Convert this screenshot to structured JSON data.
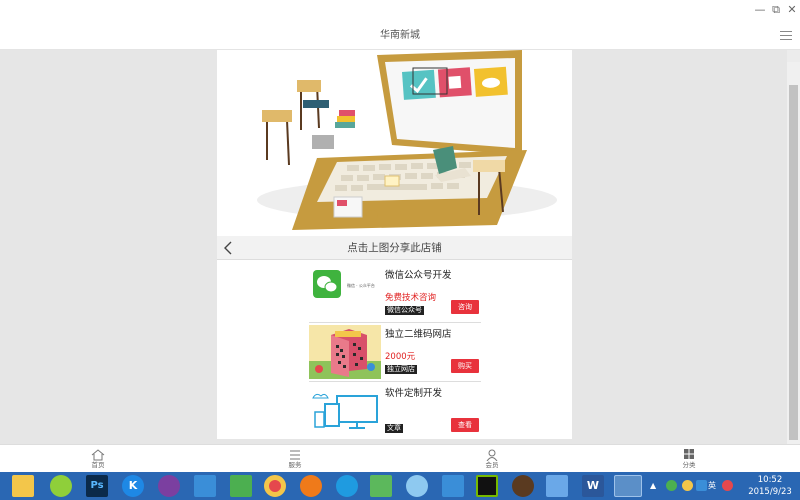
{
  "window": {
    "title": "华南新城",
    "controls": {
      "minimize": "—",
      "restore": "⧉",
      "close": "✕"
    }
  },
  "share_bar": {
    "text": "点击上图分享此店铺"
  },
  "products": [
    {
      "title": "微信公众号开发",
      "price": "免费技术咨询",
      "tag": "微信公众号",
      "button": "咨询",
      "thumb_caption": "微信 · 公众平台"
    },
    {
      "title": "独立二维码网店",
      "price": "2000元",
      "tag": "独立网店",
      "button": "购买",
      "thumb_caption": ""
    },
    {
      "title": "软件定制开发",
      "price": "",
      "tag": "文章",
      "button": "查看",
      "thumb_caption": ""
    }
  ],
  "bottom_nav": [
    {
      "label": "首页",
      "icon": "home-icon"
    },
    {
      "label": "服务",
      "icon": "list-icon"
    },
    {
      "label": "会员",
      "icon": "user-icon"
    },
    {
      "label": "分类",
      "icon": "grid-icon"
    }
  ],
  "taskbar": {
    "apps": [
      "file-explorer-icon",
      "media-player-icon",
      "photoshop-icon",
      "kugou-icon",
      "app-purple-icon",
      "pen-icon",
      "shield-icon",
      "chrome-icon",
      "firefox-icon",
      "ie-icon",
      "download-icon",
      "cloud-icon",
      "baidu-icon",
      "nvidia-icon",
      "game-icon",
      "remote-icon",
      "word-icon",
      "wechat-icon"
    ],
    "ps_label": "Ps",
    "k_label": "K",
    "w_label": "W",
    "tray": {
      "ime": "英",
      "time": "10:52",
      "date": "2015/9/23"
    }
  },
  "colors": {
    "accent": "#e8323c",
    "price": "#e02020",
    "taskbar": "#2a67b3"
  }
}
